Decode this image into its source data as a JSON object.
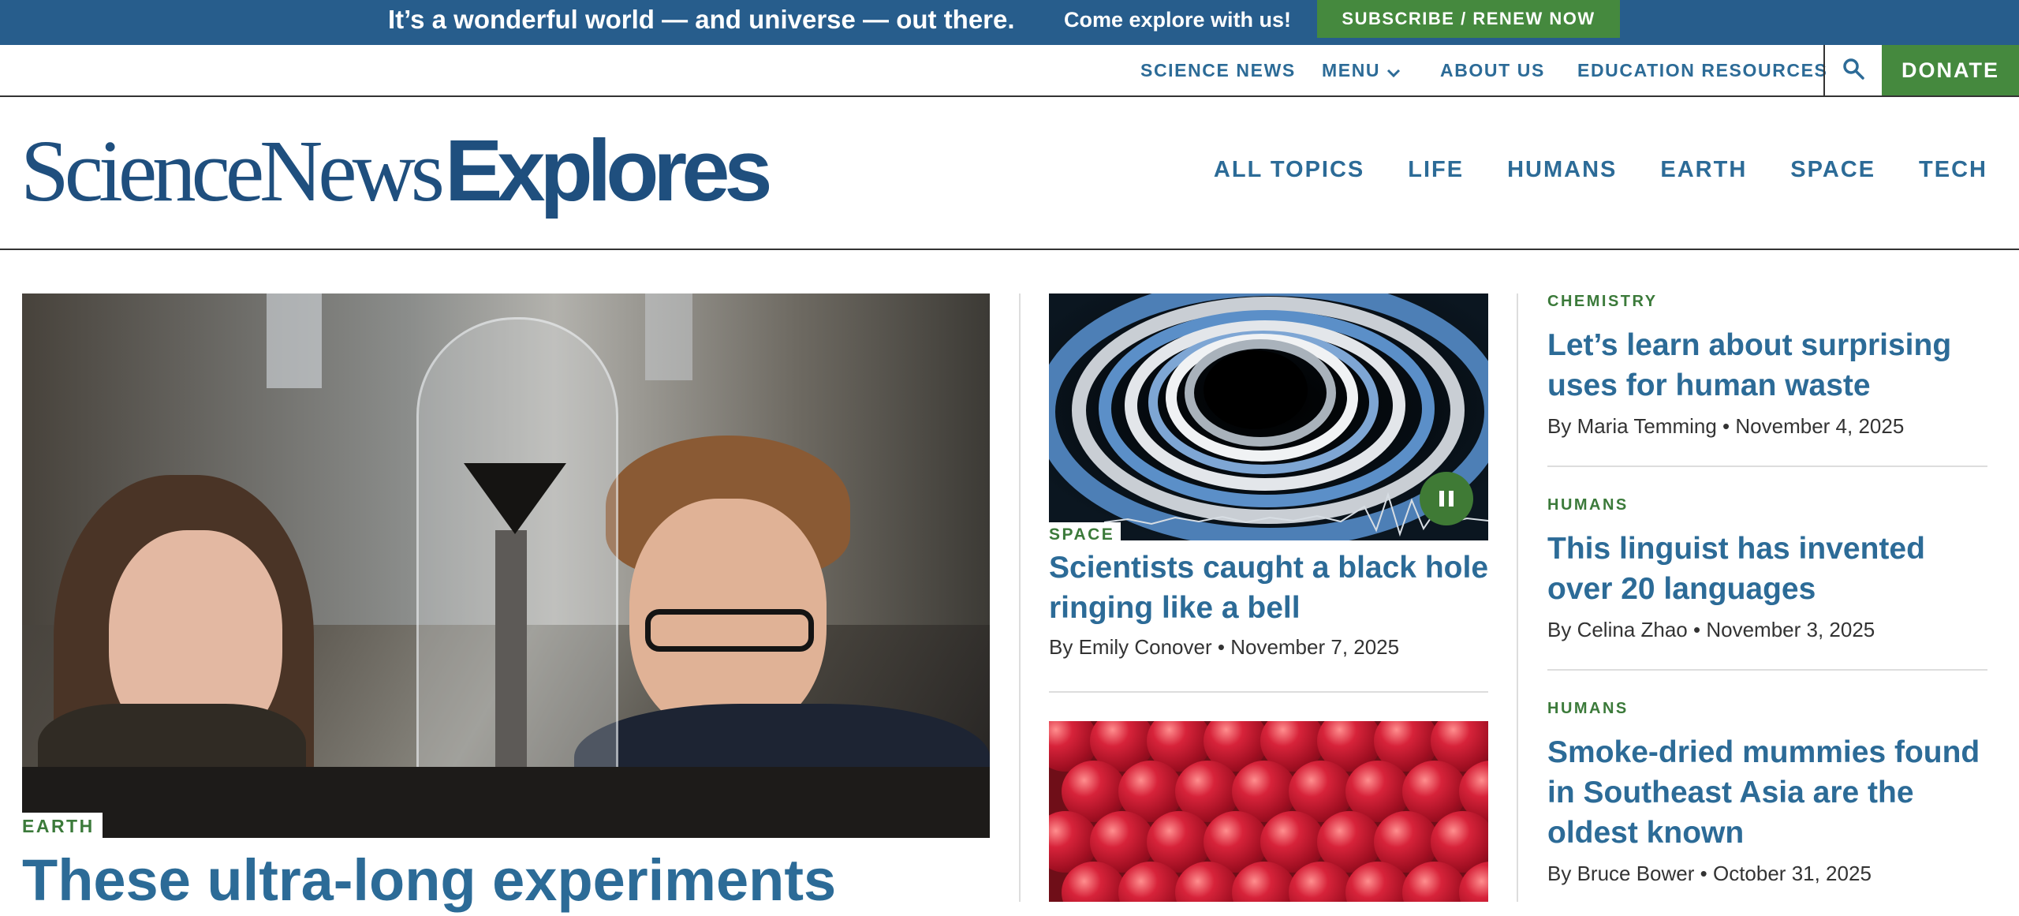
{
  "promo": {
    "headline": "It’s a wonderful world — and universe — out there.",
    "subline": "Come explore with us!",
    "subscribe_label": "SUBSCRIBE / RENEW NOW"
  },
  "utility_nav": {
    "science_news": "SCIENCE NEWS",
    "menu": "MENU",
    "about_us": "ABOUT US",
    "education_resources": "EDUCATION RESOURCES",
    "search_icon": "search-icon",
    "donate": "DONATE"
  },
  "masthead": {
    "logo_part1": "ScienceNews",
    "logo_part2": "Explores",
    "topics": [
      "ALL TOPICS",
      "LIFE",
      "HUMANS",
      "EARTH",
      "SPACE",
      "TECH"
    ]
  },
  "lead_story": {
    "category": "EARTH",
    "title": "These ultra-long experiments"
  },
  "middle_stories": [
    {
      "category": "SPACE",
      "title": "Scientists caught a black hole ringing like a bell",
      "author": "By Emily Conover",
      "date": "November 7, 2025"
    }
  ],
  "right_stories": [
    {
      "category": "CHEMISTRY",
      "title": "Let’s learn about surprising uses for human waste",
      "author": "By Maria Temming",
      "date": "November 4, 2025"
    },
    {
      "category": "HUMANS",
      "title": "This linguist has invented over 20 languages",
      "author": "By Celina Zhao",
      "date": "November 3, 2025"
    },
    {
      "category": "HUMANS",
      "title": "Smoke-dried mummies found in Southeast Asia are the oldest known",
      "author": "By Bruce Bower",
      "date": "October 31, 2025"
    }
  ],
  "byline_separator": "•",
  "colors": {
    "promo_bg": "#275d8c",
    "accent_green": "#45893e",
    "link_blue": "#2c6b97",
    "logo_blue": "#1f4f7e",
    "tag_green": "#3b7a3a"
  }
}
